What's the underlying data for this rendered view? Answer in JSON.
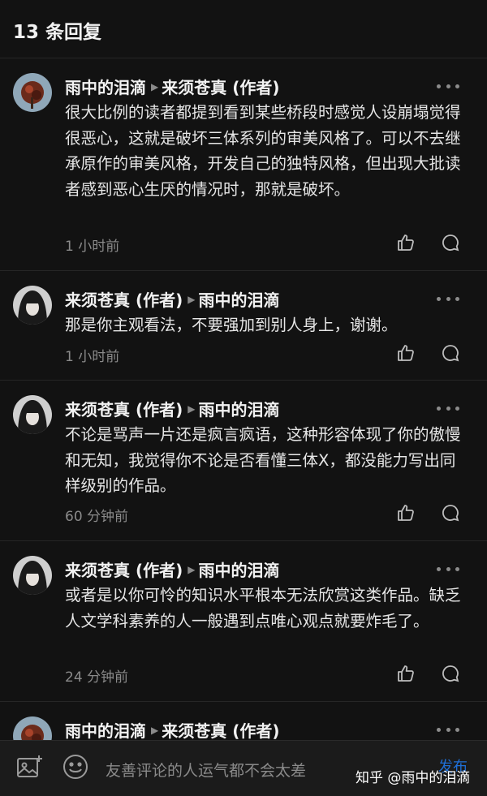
{
  "header": {
    "title": "13 条回复"
  },
  "comments": [
    {
      "author": "雨中的泪滴",
      "reply_to": "来须苍真 (作者)",
      "text": "很大比例的读者都提到看到某些桥段时感觉人设崩塌觉得很恶心，这就是破坏三体系列的审美风格了。可以不去继承原作的审美风格，开发自己的独特风格，但出现大批读者感到恶心生厌的情况时，那就是破坏。",
      "time": "1 小时前"
    },
    {
      "author": "来须苍真 (作者)",
      "reply_to": "雨中的泪滴",
      "text": "那是你主观看法，不要强加到别人身上，谢谢。",
      "time": "1 小时前"
    },
    {
      "author": "来须苍真 (作者)",
      "reply_to": "雨中的泪滴",
      "text": "不论是骂声一片还是疯言疯语，这种形容体现了你的傲慢和无知，我觉得你不论是否看懂三体X，都没能力写出同样级别的作品。",
      "time": "60 分钟前"
    },
    {
      "author": "来须苍真 (作者)",
      "reply_to": "雨中的泪滴",
      "text": "或者是以你可怜的知识水平根本无法欣赏这类作品。缺乏人文学科素养的人一般遇到点唯心观点就要炸毛了。",
      "time": "24 分钟前"
    },
    {
      "author": "雨中的泪滴",
      "reply_to": "来须苍真 (作者)"
    }
  ],
  "bottom_bar": {
    "placeholder": "友善评论的人运气都不会太差",
    "publish_label": "发布",
    "watermark": "知乎 @雨中的泪滴"
  },
  "colors": {
    "accent": "#1f6fd6",
    "background": "#121212"
  }
}
